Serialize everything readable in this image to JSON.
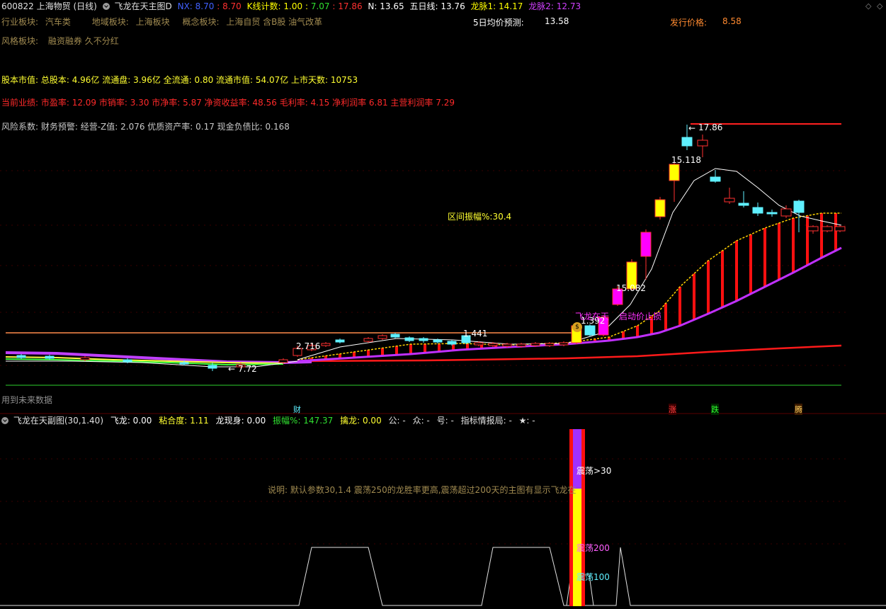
{
  "header": {
    "code": "600822",
    "name": "上海物贸",
    "period": "(日线)",
    "indicator": "飞龙在天主图D",
    "nx_label": "NX:",
    "nx_val1": "8.70",
    "nx_sep": ":",
    "nx_val2": "8.70",
    "kcount_label": "K线计数:",
    "kcount_val1": "1.00",
    "kcount_val2": "7.07",
    "kcount_val3": "17.86",
    "n_label": "N:",
    "n_val": "13.65",
    "wuri_label": "五日线:",
    "wuri_val": "13.76",
    "longmai1_label": "龙脉1:",
    "longmai1_val": "14.17",
    "longmai2_label": "龙脉2:",
    "longmai2_val": "12.73"
  },
  "info": {
    "industry_label": "行业板块:",
    "industry_val": "汽车类",
    "region_label": "地域板块:",
    "region_val": "上海板块",
    "concept_label": "概念板块:",
    "concept_val": "上海自贸 含B股 油气改革",
    "pred_label": "5日均价预测:",
    "pred_val": "13.58",
    "issue_label": "发行价格:",
    "issue_val": "8.58",
    "style_label": "风格板块:",
    "style_val": "融资融券 久不分红",
    "capital": "股本市值: 总股本: 4.96亿 流通盘: 3.96亿 全流通: 0.80 流通市值: 54.07亿 上市天数: 10753",
    "perf": "当前业绩: 市盈率: 12.09 市销率: 3.30 市净率: 5.87 净资收益率: 48.56 毛利率: 4.15 净利润率 6.81 主营利润率 7.29",
    "risk": "风险系数: 财务预警: 经营-Z值: 2.076 优质资产率: 0.17 现金负债比: 0.168"
  },
  "annotations": {
    "high": "17.86",
    "p15118": "15.118",
    "range": "区间振幅%:30.4",
    "p1582": "15.082",
    "feilong": "飞龙在天",
    "qidong": "启动价止损",
    "p1392": "1.392",
    "p1441": "1.441",
    "p2716": "2.716",
    "low": "7.72",
    "future": "用到未来数据",
    "m_cai": "财",
    "m_zhang": "涨",
    "m_die": "跌",
    "m_teng": "腾"
  },
  "sub": {
    "title": "飞龙在天副图(30,1.40)",
    "feilong": "飞龙: 0.00",
    "nianhe": "粘合度: 1.11",
    "longxian": "龙现身: 0.00",
    "zhenfu": "振幅%: 147.37",
    "qinlong": "擒龙: 0.00",
    "gong": "公: -",
    "zhong": "众: -",
    "hao": "号: -",
    "zhibiao": "指标情报局: -",
    "star": "★: -",
    "desc": "说明: 默认参数30,1.4 震荡250的龙胜率更高,震荡超过200天的主图有显示飞龙在",
    "z30": "震荡>30",
    "z200": "震荡200",
    "z100": "震荡100"
  },
  "colors": {
    "red": "#ff2a2a",
    "yellow": "#ffff00",
    "cyan": "#5ff0ff",
    "magenta": "#ff00ff",
    "purple": "#c040ff",
    "orange": "#ff7a3a"
  }
}
